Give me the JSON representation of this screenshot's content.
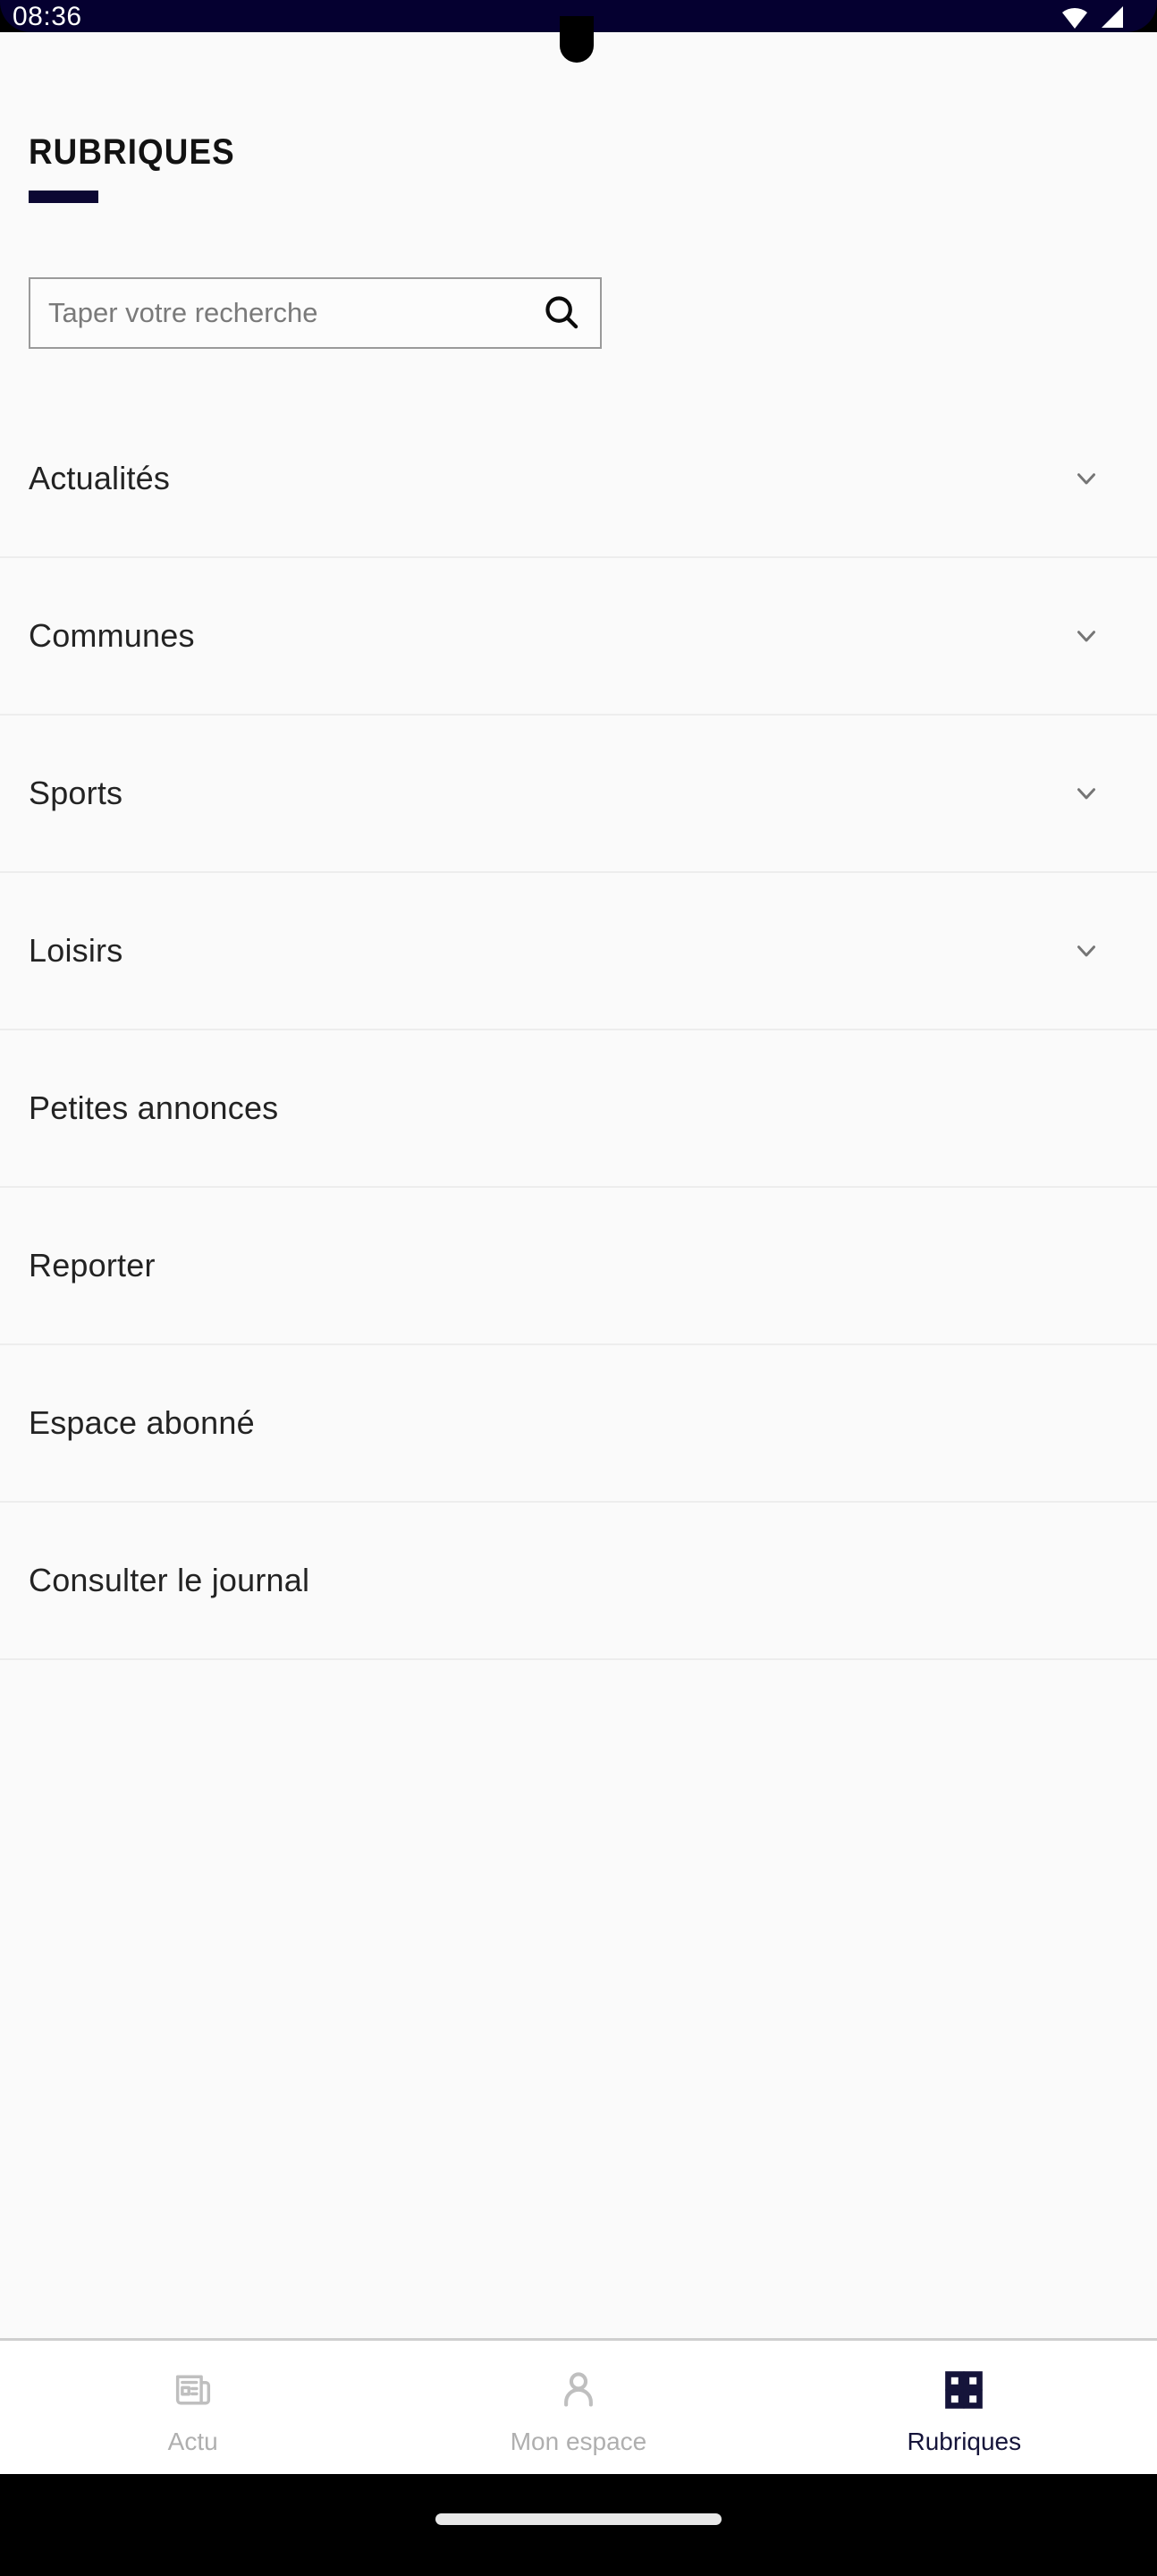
{
  "status_bar": {
    "time": "08:36",
    "wifi_icon": "wifi-icon",
    "signal_icon": "cellular-signal-icon",
    "background_color": "#050030"
  },
  "header": {
    "title": "RUBRIQUES",
    "accent_color": "#0C0833"
  },
  "search": {
    "placeholder": "Taper votre recherche",
    "value": "",
    "icon": "search-icon"
  },
  "list": {
    "items": [
      {
        "label": "Actualités",
        "expandable": true,
        "chevron": "chevron-down-icon"
      },
      {
        "label": "Communes",
        "expandable": true,
        "chevron": "chevron-down-icon"
      },
      {
        "label": "Sports",
        "expandable": true,
        "chevron": "chevron-down-icon"
      },
      {
        "label": "Loisirs",
        "expandable": true,
        "chevron": "chevron-down-icon"
      },
      {
        "label": "Petites annonces",
        "expandable": false,
        "chevron": ""
      },
      {
        "label": "Reporter",
        "expandable": false,
        "chevron": ""
      },
      {
        "label": "Espace abonné",
        "expandable": false,
        "chevron": ""
      },
      {
        "label": "Consulter le journal",
        "expandable": false,
        "chevron": ""
      }
    ]
  },
  "bottom_nav": {
    "items": [
      {
        "label": "Actu",
        "icon": "newspaper-icon",
        "active": false
      },
      {
        "label": "Mon espace",
        "icon": "person-icon",
        "active": false
      },
      {
        "label": "Rubriques",
        "icon": "grid-icon",
        "active": true
      }
    ],
    "active_color": "#15143A",
    "inactive_color": "#AFAFAF"
  }
}
